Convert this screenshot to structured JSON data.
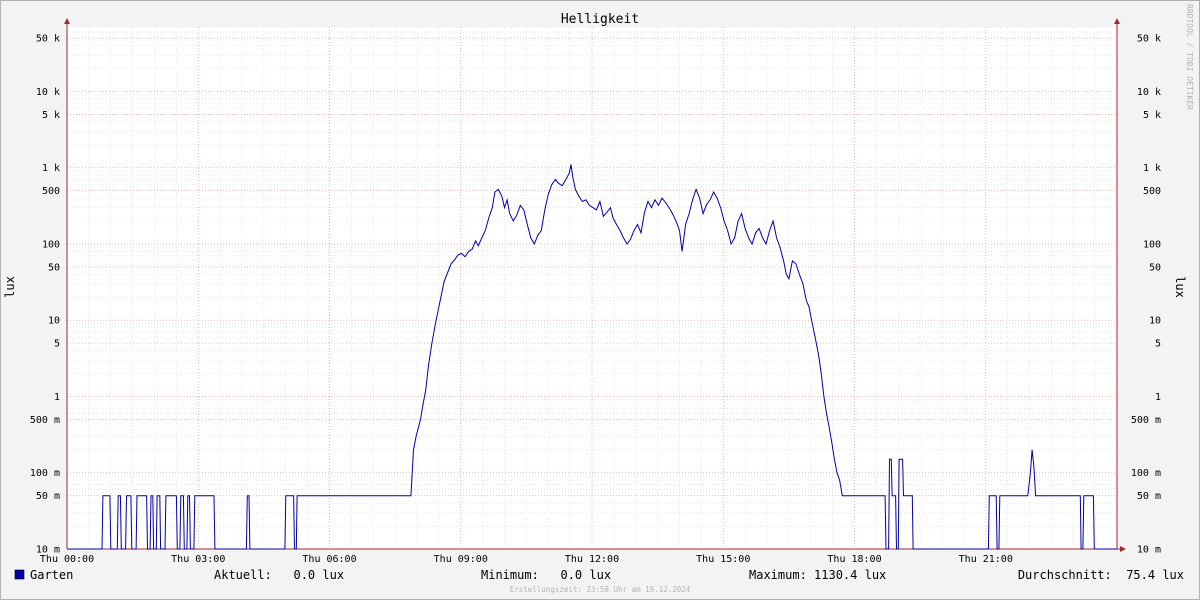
{
  "chart_data": {
    "type": "line",
    "title": "Helligkeit",
    "ylabel": "lux",
    "ylabel_right": "lux",
    "y_scale": "log",
    "ylim": [
      0.01,
      70000
    ],
    "y_ticks": [
      {
        "value": 50000,
        "label": "50 k"
      },
      {
        "value": 10000,
        "label": "10 k"
      },
      {
        "value": 5000,
        "label": "5 k"
      },
      {
        "value": 1000,
        "label": "1 k"
      },
      {
        "value": 500,
        "label": "500"
      },
      {
        "value": 100,
        "label": "100"
      },
      {
        "value": 50,
        "label": "50"
      },
      {
        "value": 10,
        "label": "10"
      },
      {
        "value": 5,
        "label": "5"
      },
      {
        "value": 1,
        "label": "1"
      },
      {
        "value": 0.5,
        "label": "500 m"
      },
      {
        "value": 0.1,
        "label": "100 m"
      },
      {
        "value": 0.05,
        "label": "50 m"
      },
      {
        "value": 0.01,
        "label": "10 m"
      }
    ],
    "x_unit": "hours",
    "xlim": [
      0,
      24
    ],
    "x_ticks": [
      {
        "value": 0,
        "label": "Thu 00:00"
      },
      {
        "value": 3,
        "label": "Thu 03:00"
      },
      {
        "value": 6,
        "label": "Thu 06:00"
      },
      {
        "value": 9,
        "label": "Thu 09:00"
      },
      {
        "value": 12,
        "label": "Thu 12:00"
      },
      {
        "value": 15,
        "label": "Thu 15:00"
      },
      {
        "value": 18,
        "label": "Thu 18:00"
      },
      {
        "value": 21,
        "label": "Thu 21:00"
      }
    ],
    "grid": true,
    "legend": "bottom-left",
    "series": [
      {
        "name": "Garten",
        "color": "#0000aa",
        "points": [
          [
            0,
            0.01
          ],
          [
            0.8,
            0.01
          ],
          [
            0.82,
            0.05
          ],
          [
            0.98,
            0.05
          ],
          [
            1.0,
            0.01
          ],
          [
            1.15,
            0.01
          ],
          [
            1.17,
            0.05
          ],
          [
            1.22,
            0.05
          ],
          [
            1.24,
            0.01
          ],
          [
            1.34,
            0.01
          ],
          [
            1.36,
            0.05
          ],
          [
            1.46,
            0.05
          ],
          [
            1.48,
            0.01
          ],
          [
            1.58,
            0.01
          ],
          [
            1.6,
            0.05
          ],
          [
            1.82,
            0.05
          ],
          [
            1.84,
            0.01
          ],
          [
            1.9,
            0.01
          ],
          [
            1.92,
            0.05
          ],
          [
            1.96,
            0.05
          ],
          [
            1.98,
            0.01
          ],
          [
            2.04,
            0.01
          ],
          [
            2.06,
            0.05
          ],
          [
            2.12,
            0.05
          ],
          [
            2.14,
            0.01
          ],
          [
            2.24,
            0.01
          ],
          [
            2.26,
            0.05
          ],
          [
            2.5,
            0.05
          ],
          [
            2.52,
            0.01
          ],
          [
            2.58,
            0.01
          ],
          [
            2.6,
            0.05
          ],
          [
            2.66,
            0.05
          ],
          [
            2.68,
            0.01
          ],
          [
            2.74,
            0.01
          ],
          [
            2.76,
            0.05
          ],
          [
            2.8,
            0.05
          ],
          [
            2.82,
            0.01
          ],
          [
            2.9,
            0.01
          ],
          [
            2.92,
            0.05
          ],
          [
            3.36,
            0.05
          ],
          [
            3.38,
            0.01
          ],
          [
            4.1,
            0.01
          ],
          [
            4.12,
            0.05
          ],
          [
            4.16,
            0.05
          ],
          [
            4.18,
            0.01
          ],
          [
            4.98,
            0.01
          ],
          [
            5.0,
            0.05
          ],
          [
            5.18,
            0.05
          ],
          [
            5.2,
            0.01
          ],
          [
            5.24,
            0.01
          ],
          [
            5.26,
            0.05
          ],
          [
            7.86,
            0.05
          ],
          [
            7.92,
            0.2
          ],
          [
            7.98,
            0.3
          ],
          [
            8.08,
            0.5
          ],
          [
            8.14,
            0.8
          ],
          [
            8.2,
            1.2
          ],
          [
            8.26,
            2.5
          ],
          [
            8.34,
            5
          ],
          [
            8.42,
            9
          ],
          [
            8.5,
            15
          ],
          [
            8.56,
            22
          ],
          [
            8.62,
            32
          ],
          [
            8.7,
            42
          ],
          [
            8.78,
            55
          ],
          [
            8.86,
            62
          ],
          [
            8.94,
            72
          ],
          [
            9.02,
            75
          ],
          [
            9.1,
            68
          ],
          [
            9.18,
            80
          ],
          [
            9.26,
            85
          ],
          [
            9.34,
            110
          ],
          [
            9.4,
            95
          ],
          [
            9.48,
            120
          ],
          [
            9.56,
            150
          ],
          [
            9.64,
            220
          ],
          [
            9.72,
            300
          ],
          [
            9.78,
            480
          ],
          [
            9.86,
            520
          ],
          [
            9.94,
            420
          ],
          [
            10.0,
            300
          ],
          [
            10.06,
            380
          ],
          [
            10.12,
            250
          ],
          [
            10.2,
            200
          ],
          [
            10.28,
            240
          ],
          [
            10.36,
            320
          ],
          [
            10.44,
            280
          ],
          [
            10.52,
            180
          ],
          [
            10.6,
            120
          ],
          [
            10.68,
            100
          ],
          [
            10.76,
            130
          ],
          [
            10.84,
            150
          ],
          [
            10.92,
            280
          ],
          [
            11.0,
            450
          ],
          [
            11.08,
            600
          ],
          [
            11.16,
            700
          ],
          [
            11.24,
            620
          ],
          [
            11.32,
            580
          ],
          [
            11.4,
            700
          ],
          [
            11.48,
            850
          ],
          [
            11.52,
            1100
          ],
          [
            11.56,
            750
          ],
          [
            11.62,
            520
          ],
          [
            11.7,
            420
          ],
          [
            11.78,
            360
          ],
          [
            11.86,
            380
          ],
          [
            11.94,
            320
          ],
          [
            12.02,
            300
          ],
          [
            12.1,
            280
          ],
          [
            12.18,
            360
          ],
          [
            12.26,
            230
          ],
          [
            12.34,
            260
          ],
          [
            12.42,
            300
          ],
          [
            12.48,
            220
          ],
          [
            12.56,
            180
          ],
          [
            12.64,
            150
          ],
          [
            12.72,
            120
          ],
          [
            12.8,
            100
          ],
          [
            12.88,
            115
          ],
          [
            12.96,
            150
          ],
          [
            13.04,
            180
          ],
          [
            13.12,
            140
          ],
          [
            13.2,
            260
          ],
          [
            13.28,
            360
          ],
          [
            13.36,
            300
          ],
          [
            13.44,
            380
          ],
          [
            13.52,
            320
          ],
          [
            13.6,
            400
          ],
          [
            13.68,
            350
          ],
          [
            13.76,
            300
          ],
          [
            13.84,
            250
          ],
          [
            13.92,
            200
          ],
          [
            14.0,
            150
          ],
          [
            14.06,
            80
          ],
          [
            14.14,
            180
          ],
          [
            14.22,
            250
          ],
          [
            14.3,
            380
          ],
          [
            14.38,
            520
          ],
          [
            14.46,
            400
          ],
          [
            14.54,
            250
          ],
          [
            14.62,
            330
          ],
          [
            14.7,
            380
          ],
          [
            14.78,
            480
          ],
          [
            14.86,
            400
          ],
          [
            14.94,
            300
          ],
          [
            15.02,
            200
          ],
          [
            15.1,
            150
          ],
          [
            15.18,
            100
          ],
          [
            15.26,
            120
          ],
          [
            15.34,
            200
          ],
          [
            15.42,
            250
          ],
          [
            15.5,
            160
          ],
          [
            15.58,
            120
          ],
          [
            15.66,
            100
          ],
          [
            15.74,
            140
          ],
          [
            15.82,
            160
          ],
          [
            15.9,
            120
          ],
          [
            15.98,
            100
          ],
          [
            16.06,
            150
          ],
          [
            16.14,
            200
          ],
          [
            16.22,
            120
          ],
          [
            16.3,
            90
          ],
          [
            16.38,
            60
          ],
          [
            16.44,
            40
          ],
          [
            16.5,
            35
          ],
          [
            16.58,
            60
          ],
          [
            16.66,
            55
          ],
          [
            16.74,
            40
          ],
          [
            16.82,
            30
          ],
          [
            16.9,
            18
          ],
          [
            16.96,
            15
          ],
          [
            17.02,
            10
          ],
          [
            17.1,
            6
          ],
          [
            17.18,
            3.5
          ],
          [
            17.24,
            2
          ],
          [
            17.3,
            1
          ],
          [
            17.36,
            0.6
          ],
          [
            17.42,
            0.4
          ],
          [
            17.48,
            0.25
          ],
          [
            17.54,
            0.15
          ],
          [
            17.6,
            0.1
          ],
          [
            17.66,
            0.08
          ],
          [
            17.72,
            0.05
          ],
          [
            18.7,
            0.05
          ],
          [
            18.72,
            0.01
          ],
          [
            18.78,
            0.01
          ],
          [
            18.8,
            0.15
          ],
          [
            18.84,
            0.15
          ],
          [
            18.86,
            0.05
          ],
          [
            18.94,
            0.05
          ],
          [
            18.96,
            0.01
          ],
          [
            19.0,
            0.01
          ],
          [
            19.02,
            0.15
          ],
          [
            19.1,
            0.15
          ],
          [
            19.12,
            0.05
          ],
          [
            19.32,
            0.05
          ],
          [
            19.34,
            0.01
          ],
          [
            21.06,
            0.01
          ],
          [
            21.08,
            0.05
          ],
          [
            21.24,
            0.05
          ],
          [
            21.26,
            0.01
          ],
          [
            21.3,
            0.01
          ],
          [
            21.32,
            0.05
          ],
          [
            21.96,
            0.05
          ],
          [
            22.02,
            0.1
          ],
          [
            22.06,
            0.2
          ],
          [
            22.1,
            0.12
          ],
          [
            22.14,
            0.05
          ],
          [
            23.16,
            0.05
          ],
          [
            23.18,
            0.01
          ],
          [
            23.22,
            0.01
          ],
          [
            23.24,
            0.05
          ],
          [
            23.46,
            0.05
          ],
          [
            23.48,
            0.01
          ],
          [
            24,
            0.01
          ]
        ]
      }
    ]
  },
  "legend": {
    "series_name": "Garten",
    "current": "Aktuell:   0.0 lux",
    "minimum": "Minimum:   0.0 lux",
    "maximum": "Maximum: 1130.4 lux",
    "average": "Durchschnitt:  75.4 lux"
  },
  "footer": "Erstellungszeit: 23:58 Uhr am 19.12.2024",
  "watermark": "RRDTOOL / TOBI OETIKER",
  "colors": {
    "background": "#f3f3f3",
    "plot_background": "#ffffff",
    "minor_grid": "#d8d8d8",
    "major_grid": "#e8a0a0",
    "axis": "#a52a2a",
    "series": "#0000aa"
  }
}
